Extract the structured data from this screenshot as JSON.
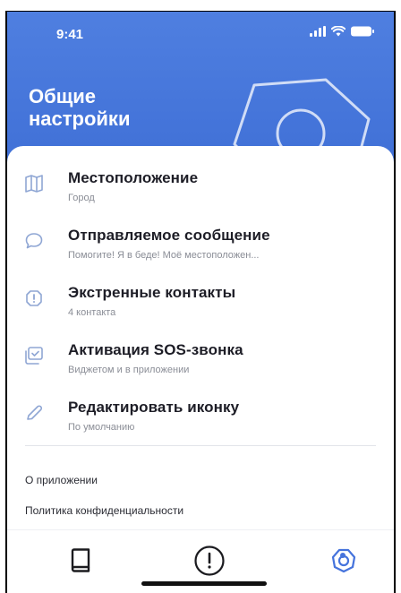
{
  "status": {
    "time": "9:41"
  },
  "header": {
    "title": "Общие\nнастройки"
  },
  "menu": [
    {
      "title": "Местоположение",
      "subtitle": "Город",
      "icon": "map-icon"
    },
    {
      "title": "Отправляемое сообщение",
      "subtitle": "Помогите! Я в беде! Моё местоположен...",
      "icon": "chat-bubble-icon"
    },
    {
      "title": "Экстренные контакты",
      "subtitle": "4 контакта",
      "icon": "alert-icon"
    },
    {
      "title": "Активация SOS-звонка",
      "subtitle": "Виджетом и в приложении",
      "icon": "widget-check-icon"
    },
    {
      "title": "Редактировать иконку",
      "subtitle": "По умолчанию",
      "icon": "pencil-icon"
    }
  ],
  "links": {
    "about": "О приложении",
    "privacy": "Политика конфиденциальности"
  },
  "tabs": [
    {
      "icon": "book-icon",
      "active": false
    },
    {
      "icon": "exclamation-circle-icon",
      "active": false
    },
    {
      "icon": "settings-icon",
      "active": true
    }
  ],
  "colors": {
    "accent": "#4573dc",
    "header_bg": "#4676de",
    "text": "#1d1d26",
    "subtext": "#8a8d96"
  }
}
